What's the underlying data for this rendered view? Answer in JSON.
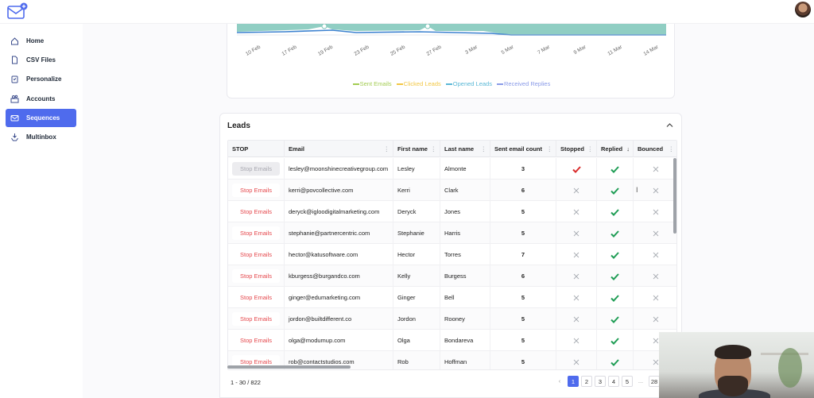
{
  "sidebar": {
    "items": [
      {
        "label": "Home",
        "icon": "home-icon"
      },
      {
        "label": "CSV Files",
        "icon": "file-icon"
      },
      {
        "label": "Personalize",
        "icon": "clipboard-icon"
      },
      {
        "label": "Accounts",
        "icon": "accounts-icon"
      },
      {
        "label": "Sequences",
        "icon": "mail-icon",
        "active": true
      },
      {
        "label": "Multinbox",
        "icon": "inbox-icon"
      }
    ]
  },
  "chart_data": {
    "type": "area",
    "x": [
      "10 Feb",
      "17 Feb",
      "19 Feb",
      "23 Feb",
      "25 Feb",
      "27 Feb",
      "3 Mar",
      "5 Mar",
      "7 Mar",
      "9 Mar",
      "11 Mar",
      "14 Mar"
    ],
    "series": [
      {
        "name": "Sent Emails",
        "color": "#a3cc52"
      },
      {
        "name": "Clicked Leads",
        "color": "#f2c744"
      },
      {
        "name": "Opened Leads",
        "color": "#5ab8d6"
      },
      {
        "name": "Received Replies",
        "color": "#8a9be8"
      }
    ]
  },
  "leads": {
    "title": "Leads",
    "columns": [
      "STOP",
      "Email",
      "First name",
      "Last name",
      "Sent email count",
      "Stopped",
      "Replied",
      "Bounced"
    ],
    "rows": [
      {
        "stop": "Stop Emails",
        "disabled": true,
        "email": "lesley@moonshinecreativegroup.com",
        "first": "Lesley",
        "last": "Almonte",
        "count": "3",
        "stopped": true,
        "replied": true,
        "bounced": false
      },
      {
        "stop": "Stop Emails",
        "disabled": false,
        "email": "kerri@povcollective.com",
        "first": "Kerri",
        "last": "Clark",
        "count": "6",
        "stopped": false,
        "replied": true,
        "bounced": false
      },
      {
        "stop": "Stop Emails",
        "disabled": false,
        "email": "deryck@igloodigitalmarketing.com",
        "first": "Deryck",
        "last": "Jones",
        "count": "5",
        "stopped": false,
        "replied": true,
        "bounced": false
      },
      {
        "stop": "Stop Emails",
        "disabled": false,
        "email": "stephanie@partnercentric.com",
        "first": "Stephanie",
        "last": "Harris",
        "count": "5",
        "stopped": false,
        "replied": true,
        "bounced": false
      },
      {
        "stop": "Stop Emails",
        "disabled": false,
        "email": "hector@katusoftware.com",
        "first": "Hector",
        "last": "Torres",
        "count": "7",
        "stopped": false,
        "replied": true,
        "bounced": false
      },
      {
        "stop": "Stop Emails",
        "disabled": false,
        "email": "kburgess@burgandco.com",
        "first": "Kelly",
        "last": "Burgess",
        "count": "6",
        "stopped": false,
        "replied": true,
        "bounced": false
      },
      {
        "stop": "Stop Emails",
        "disabled": false,
        "email": "ginger@edumarketing.com",
        "first": "Ginger",
        "last": "Bell",
        "count": "5",
        "stopped": false,
        "replied": true,
        "bounced": false
      },
      {
        "stop": "Stop Emails",
        "disabled": false,
        "email": "jordon@builtdifferent.co",
        "first": "Jordon",
        "last": "Rooney",
        "count": "5",
        "stopped": false,
        "replied": true,
        "bounced": false
      },
      {
        "stop": "Stop Emails",
        "disabled": false,
        "email": "olga@modumup.com",
        "first": "Olga",
        "last": "Bondareva",
        "count": "5",
        "stopped": false,
        "replied": true,
        "bounced": false
      },
      {
        "stop": "Stop Emails",
        "disabled": false,
        "email": "rob@contactstudios.com",
        "first": "Rob",
        "last": "Hoffman",
        "count": "5",
        "stopped": false,
        "replied": true,
        "bounced": false
      }
    ]
  },
  "pagination": {
    "range": "1 - 30 / 822",
    "pages": [
      "1",
      "2",
      "3",
      "4",
      "5",
      "...",
      "28"
    ],
    "current": "1"
  },
  "colors": {
    "accent": "#4f6bed",
    "check_green": "#1f9d55",
    "check_red": "#d92d2d",
    "stop_red": "#e5484d"
  }
}
